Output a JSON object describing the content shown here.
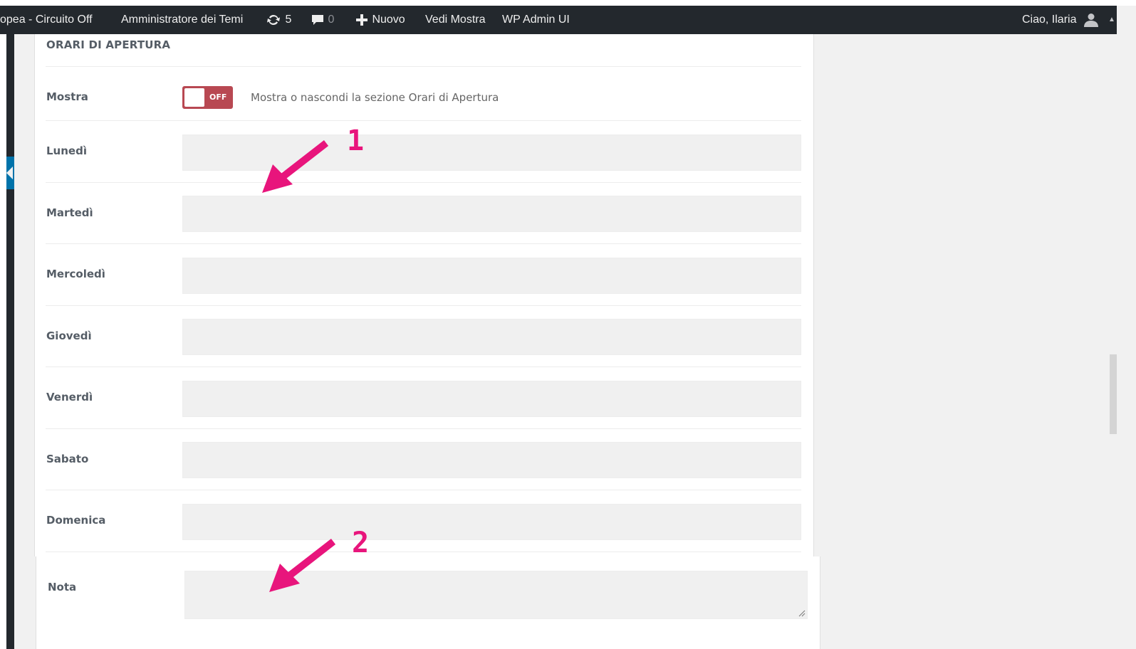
{
  "adminbar": {
    "site_name": "opea - Circuito Off",
    "theme_admin": "Amministratore dei Temi",
    "updates_count": "5",
    "comments_count": "0",
    "new_label": "Nuovo",
    "view_label": "Vedi Mostra",
    "wp_admin_ui": "WP Admin UI",
    "greeting": "Ciao, Ilaria"
  },
  "section": {
    "title": "ORARI DI APERTURA"
  },
  "show_toggle": {
    "label": "Mostra",
    "state": "OFF",
    "description": "Mostra o nascondi la sezione Orari di Apertura"
  },
  "days": [
    {
      "label": "Lunedì",
      "value": ""
    },
    {
      "label": "Martedì",
      "value": ""
    },
    {
      "label": "Mercoledì",
      "value": ""
    },
    {
      "label": "Giovedì",
      "value": ""
    },
    {
      "label": "Venerdì",
      "value": ""
    },
    {
      "label": "Sabato",
      "value": ""
    },
    {
      "label": "Domenica",
      "value": ""
    }
  ],
  "note": {
    "label": "Nota",
    "value": ""
  },
  "annotations": [
    "1",
    "2"
  ],
  "colors": {
    "adminbar_bg": "#23282d",
    "toggle_off": "#b84852",
    "annotation": "#e8157c",
    "input_bg": "#f0f0f0",
    "accent_tab": "#0073aa"
  }
}
